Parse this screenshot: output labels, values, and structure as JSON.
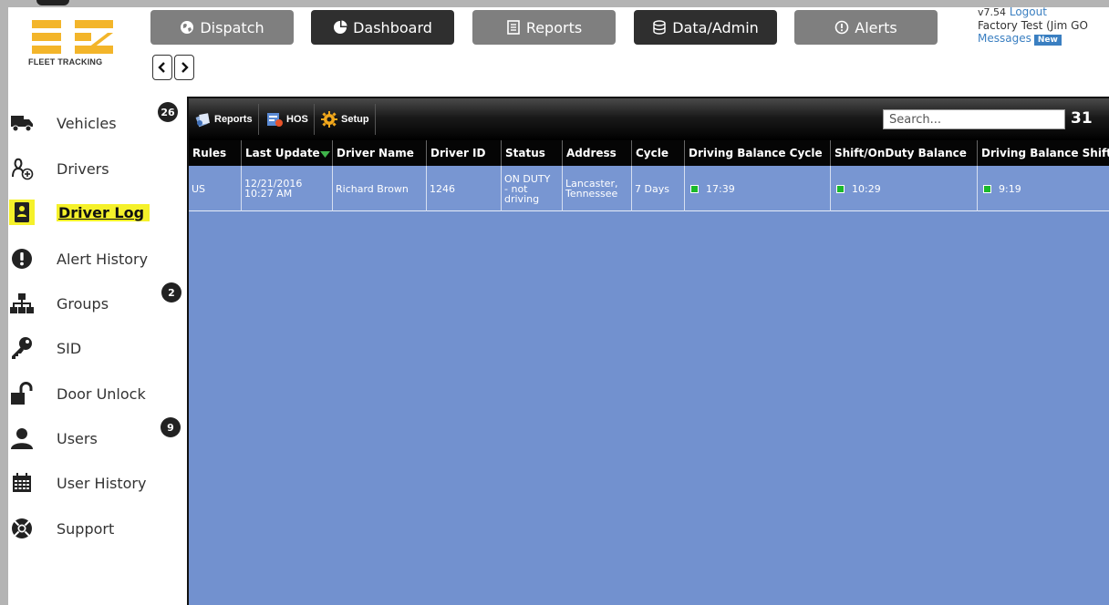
{
  "nav": {
    "dispatch": "Dispatch",
    "dashboard": "Dashboard",
    "reports": "Reports",
    "data_admin": "Data/Admin",
    "alerts": "Alerts"
  },
  "logo": {
    "text": "FLEET TRACKING"
  },
  "user": {
    "version": "v7.54",
    "logout": "Logout",
    "account": "Factory Test (Jim GO",
    "messages": "Messages",
    "new_badge": "New"
  },
  "sidebar": {
    "items": [
      {
        "label": "Vehicles",
        "icon": "truck-icon"
      },
      {
        "label": "Drivers",
        "icon": "driver-add-icon"
      },
      {
        "label": "Driver Log",
        "icon": "logbook-icon",
        "active": true
      },
      {
        "label": "Alert History",
        "icon": "exclamation-icon"
      },
      {
        "label": "Groups",
        "icon": "sitemap-icon"
      },
      {
        "label": "SID",
        "icon": "key-icon"
      },
      {
        "label": "Door Unlock",
        "icon": "unlock-icon"
      },
      {
        "label": "Users",
        "icon": "user-icon"
      },
      {
        "label": "User History",
        "icon": "calendar-icon"
      },
      {
        "label": "Support",
        "icon": "life-ring-icon"
      }
    ],
    "badges": {
      "vehicles": "26",
      "groups": "2",
      "users": "9"
    }
  },
  "toolbar": {
    "reports": "Reports",
    "hos": "HOS",
    "setup": "Setup",
    "search_placeholder": "Search...",
    "count": "31"
  },
  "table": {
    "headers": [
      "Rules",
      "Last Update",
      "Driver Name",
      "Driver ID",
      "Status",
      "Address",
      "Cycle",
      "Driving Balance Cycle",
      "Shift/OnDuty Balance",
      "Driving Balance Shift"
    ],
    "rows": [
      {
        "rules": "US",
        "last_update_date": "12/21/2016",
        "last_update_time": "10:27 AM",
        "driver_name": "Richard Brown",
        "driver_id": "1246",
        "status_1": "ON DUTY",
        "status_2": "- not",
        "status_3": "driving",
        "address_1": "Lancaster,",
        "address_2": "Tennessee",
        "cycle": "7 Days",
        "driving_balance_cycle": "17:39",
        "shift_onduty_balance": "10:29",
        "driving_balance_shift": "9:19"
      }
    ]
  },
  "colors": {
    "panel_bg": "#7291cf",
    "highlight": "#f5f12a",
    "link": "#3a7fc1",
    "status_ok": "#1bb92a"
  }
}
